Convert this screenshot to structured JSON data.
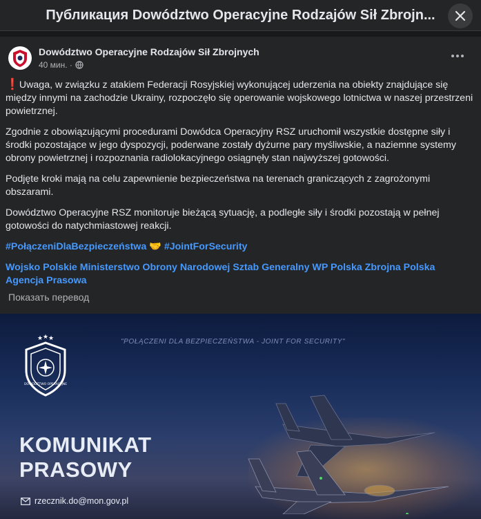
{
  "window": {
    "title": "Публикация Dowództwo Operacyjne Rodzajów Sił Zbrojn..."
  },
  "post": {
    "author": "Dowództwo Operacyjne Rodzajów Sił Zbrojnych",
    "time": "40 мин. ·",
    "paragraphs": [
      "Uwaga, w związku z atakiem Federacji Rosyjskiej wykonującej uderzenia na obiekty znajdujące się między innymi na zachodzie Ukrainy, rozpoczęło się operowanie wojskowego lotnictwa w naszej przestrzeni powietrznej.",
      "Zgodnie z obowiązującymi procedurami Dowódca Operacyjny RSZ uruchomił wszystkie dostępne siły i środki pozostające w jego dyspozycji, poderwane zostały dyżurne pary myśliwskie, a naziemne systemy obrony powietrznej i rozpoznania radiolokacyjnego osiągnęły stan najwyższej gotowości.",
      "Podjęte kroki mają na celu zapewnienie bezpieczeństwa na terenach graniczących z zagrożonymi obszarami.",
      "Dowództwo Operacyjne RSZ monitoruje bieżącą sytuację, a podległe siły i środki pozostają w pełnej gotowości do natychmiastowej reakcji."
    ],
    "hashtags": [
      "#PołączeniDlaBezpieczeństwa",
      "#JointForSecurity"
    ],
    "mentions": [
      "Wojsko Polskie",
      "Ministerstwo Obrony Narodowej",
      "Sztab Generalny WP",
      "Polska Zbrojna",
      "Polska Agencja Prasowa"
    ],
    "translate_label": "Показать перевод",
    "more_icon": "more-horizontal-icon",
    "privacy_icon": "globe-icon"
  },
  "banner": {
    "slogan": "\"POŁĄCZENI DLA BEZPIECZEŃSTWA - JOINT FOR SECURITY\"",
    "title_line1": "KOMUNIKAT",
    "title_line2": "PRASOWY",
    "email": "rzecznik.do@mon.gov.pl",
    "emblem_text": "DOWÓDZTWO OPERACYJNE"
  },
  "colors": {
    "background": "#18191a",
    "card": "#242526",
    "link": "#4599ff",
    "alert": "#e41e3f"
  }
}
